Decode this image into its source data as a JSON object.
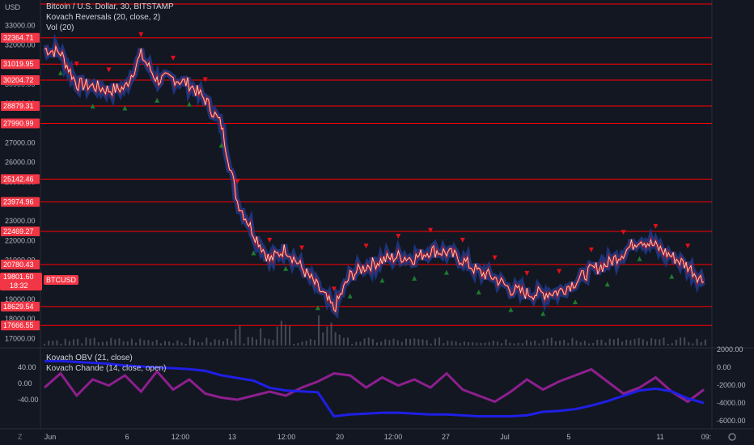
{
  "header": {
    "currency_label": "USD",
    "title": "Bitcoin / U.S. Dollar, 30, BITSTAMP",
    "indicator1": "Kovach Reversals (20, close, 2)",
    "indicator2": "Vol (20)",
    "lower_indicator1": "Kovach OBV (21, close)",
    "lower_indicator2": "Kovach Chande (14, close, open)"
  },
  "price_axis": {
    "ticks": [
      "33000.00",
      "32000.00",
      "31000.00",
      "30000.00",
      "29000.00",
      "28000.00",
      "27000.00",
      "26000.00",
      "25000.00",
      "24000.00",
      "23000.00",
      "22000.00",
      "21000.00",
      "20000.00",
      "19000.00",
      "18000.00",
      "17000.00"
    ]
  },
  "level_lines": {
    "color": "#ff0000",
    "values": [
      "32364.71",
      "31019.95",
      "30204.72",
      "28879.31",
      "27990.99",
      "25142.46",
      "23974.96",
      "22469.27",
      "20780.43",
      "18629.54",
      "17666.55"
    ]
  },
  "last_price": {
    "value": "19801.60",
    "countdown": "18:32",
    "symbol": "BTCUSD"
  },
  "time_axis": {
    "labels": [
      "Jun",
      "6",
      "12:00",
      "13",
      "12:00",
      "20",
      "12:00",
      "27",
      "Jul",
      "5",
      "11",
      "09:"
    ]
  },
  "lower_left_axis": {
    "ticks": [
      "40.00",
      "0.00",
      "-40.00"
    ]
  },
  "lower_right_axis": {
    "ticks": [
      "2000.00",
      "0.00",
      "-2000.00",
      "-4000.00",
      "-6000.00"
    ]
  },
  "controls": {
    "z_label": "Z",
    "close_icon": "close-icon",
    "settings_icon": "gear-icon"
  },
  "colors": {
    "background": "#131722",
    "price_line": "#e6e6e6",
    "level_line": "#ff0000",
    "down_marker": "#e0101a",
    "up_marker": "#1e7b2e",
    "obv_line": "#1f1fe6",
    "chande_line": "#8e1f8e",
    "band_blue": "#1f3a8a",
    "band_red": "#c21a1a"
  },
  "chart_data": {
    "type": "line",
    "title": "Bitcoin / U.S. Dollar, 30, BITSTAMP",
    "ylim": [
      16600,
      33800
    ],
    "x": [
      "Jun 1",
      "Jun 2",
      "Jun 3",
      "Jun 4",
      "Jun 5",
      "Jun 6",
      "Jun 7",
      "Jun 8",
      "Jun 9",
      "Jun 10",
      "Jun 11",
      "Jun 12",
      "Jun 13",
      "Jun 14",
      "Jun 15",
      "Jun 16",
      "Jun 17",
      "Jun 18",
      "Jun 19",
      "Jun 20",
      "Jun 21",
      "Jun 22",
      "Jun 23",
      "Jun 24",
      "Jun 25",
      "Jun 26",
      "Jun 27",
      "Jun 28",
      "Jun 29",
      "Jun 30",
      "Jul 1",
      "Jul 2",
      "Jul 3",
      "Jul 4",
      "Jul 5",
      "Jul 6",
      "Jul 7",
      "Jul 8",
      "Jul 9",
      "Jul 10",
      "Jul 11",
      "Jul 12"
    ],
    "series": [
      {
        "values": [
          31800,
          31600,
          30000,
          29900,
          29700,
          29800,
          31500,
          30200,
          30300,
          30000,
          29200,
          27900,
          24000,
          22400,
          21000,
          21600,
          20600,
          19600,
          18500,
          20200,
          20700,
          21000,
          21200,
          21100,
          21500,
          21400,
          21000,
          20400,
          20100,
          19500,
          19300,
          19300,
          19400,
          19900,
          20500,
          20800,
          21400,
          22100,
          21700,
          21200,
          20700,
          19900
        ],
        "obv": [
          700,
          700,
          600,
          500,
          400,
          200,
          100,
          0,
          -100,
          -200,
          -400,
          -900,
          -1200,
          -1500,
          -2300,
          -2600,
          -2700,
          -2800,
          -5500,
          -5300,
          -5200,
          -5100,
          -5100,
          -5200,
          -5300,
          -5300,
          -5400,
          -5500,
          -5500,
          -5500,
          -5400,
          -5000,
          -4900,
          -4700,
          -4300,
          -3800,
          -3200,
          -2600,
          -2400,
          -2700,
          -3500,
          -4000
        ],
        "chande": [
          -10,
          25,
          -30,
          10,
          -5,
          20,
          -20,
          30,
          -15,
          10,
          -25,
          -35,
          -40,
          -30,
          -20,
          -30,
          -10,
          5,
          25,
          20,
          -10,
          15,
          -5,
          10,
          -10,
          25,
          -15,
          -30,
          -45,
          -20,
          10,
          -15,
          5,
          20,
          35,
          5,
          -25,
          -10,
          15,
          -20,
          -45,
          -15
        ]
      }
    ]
  }
}
